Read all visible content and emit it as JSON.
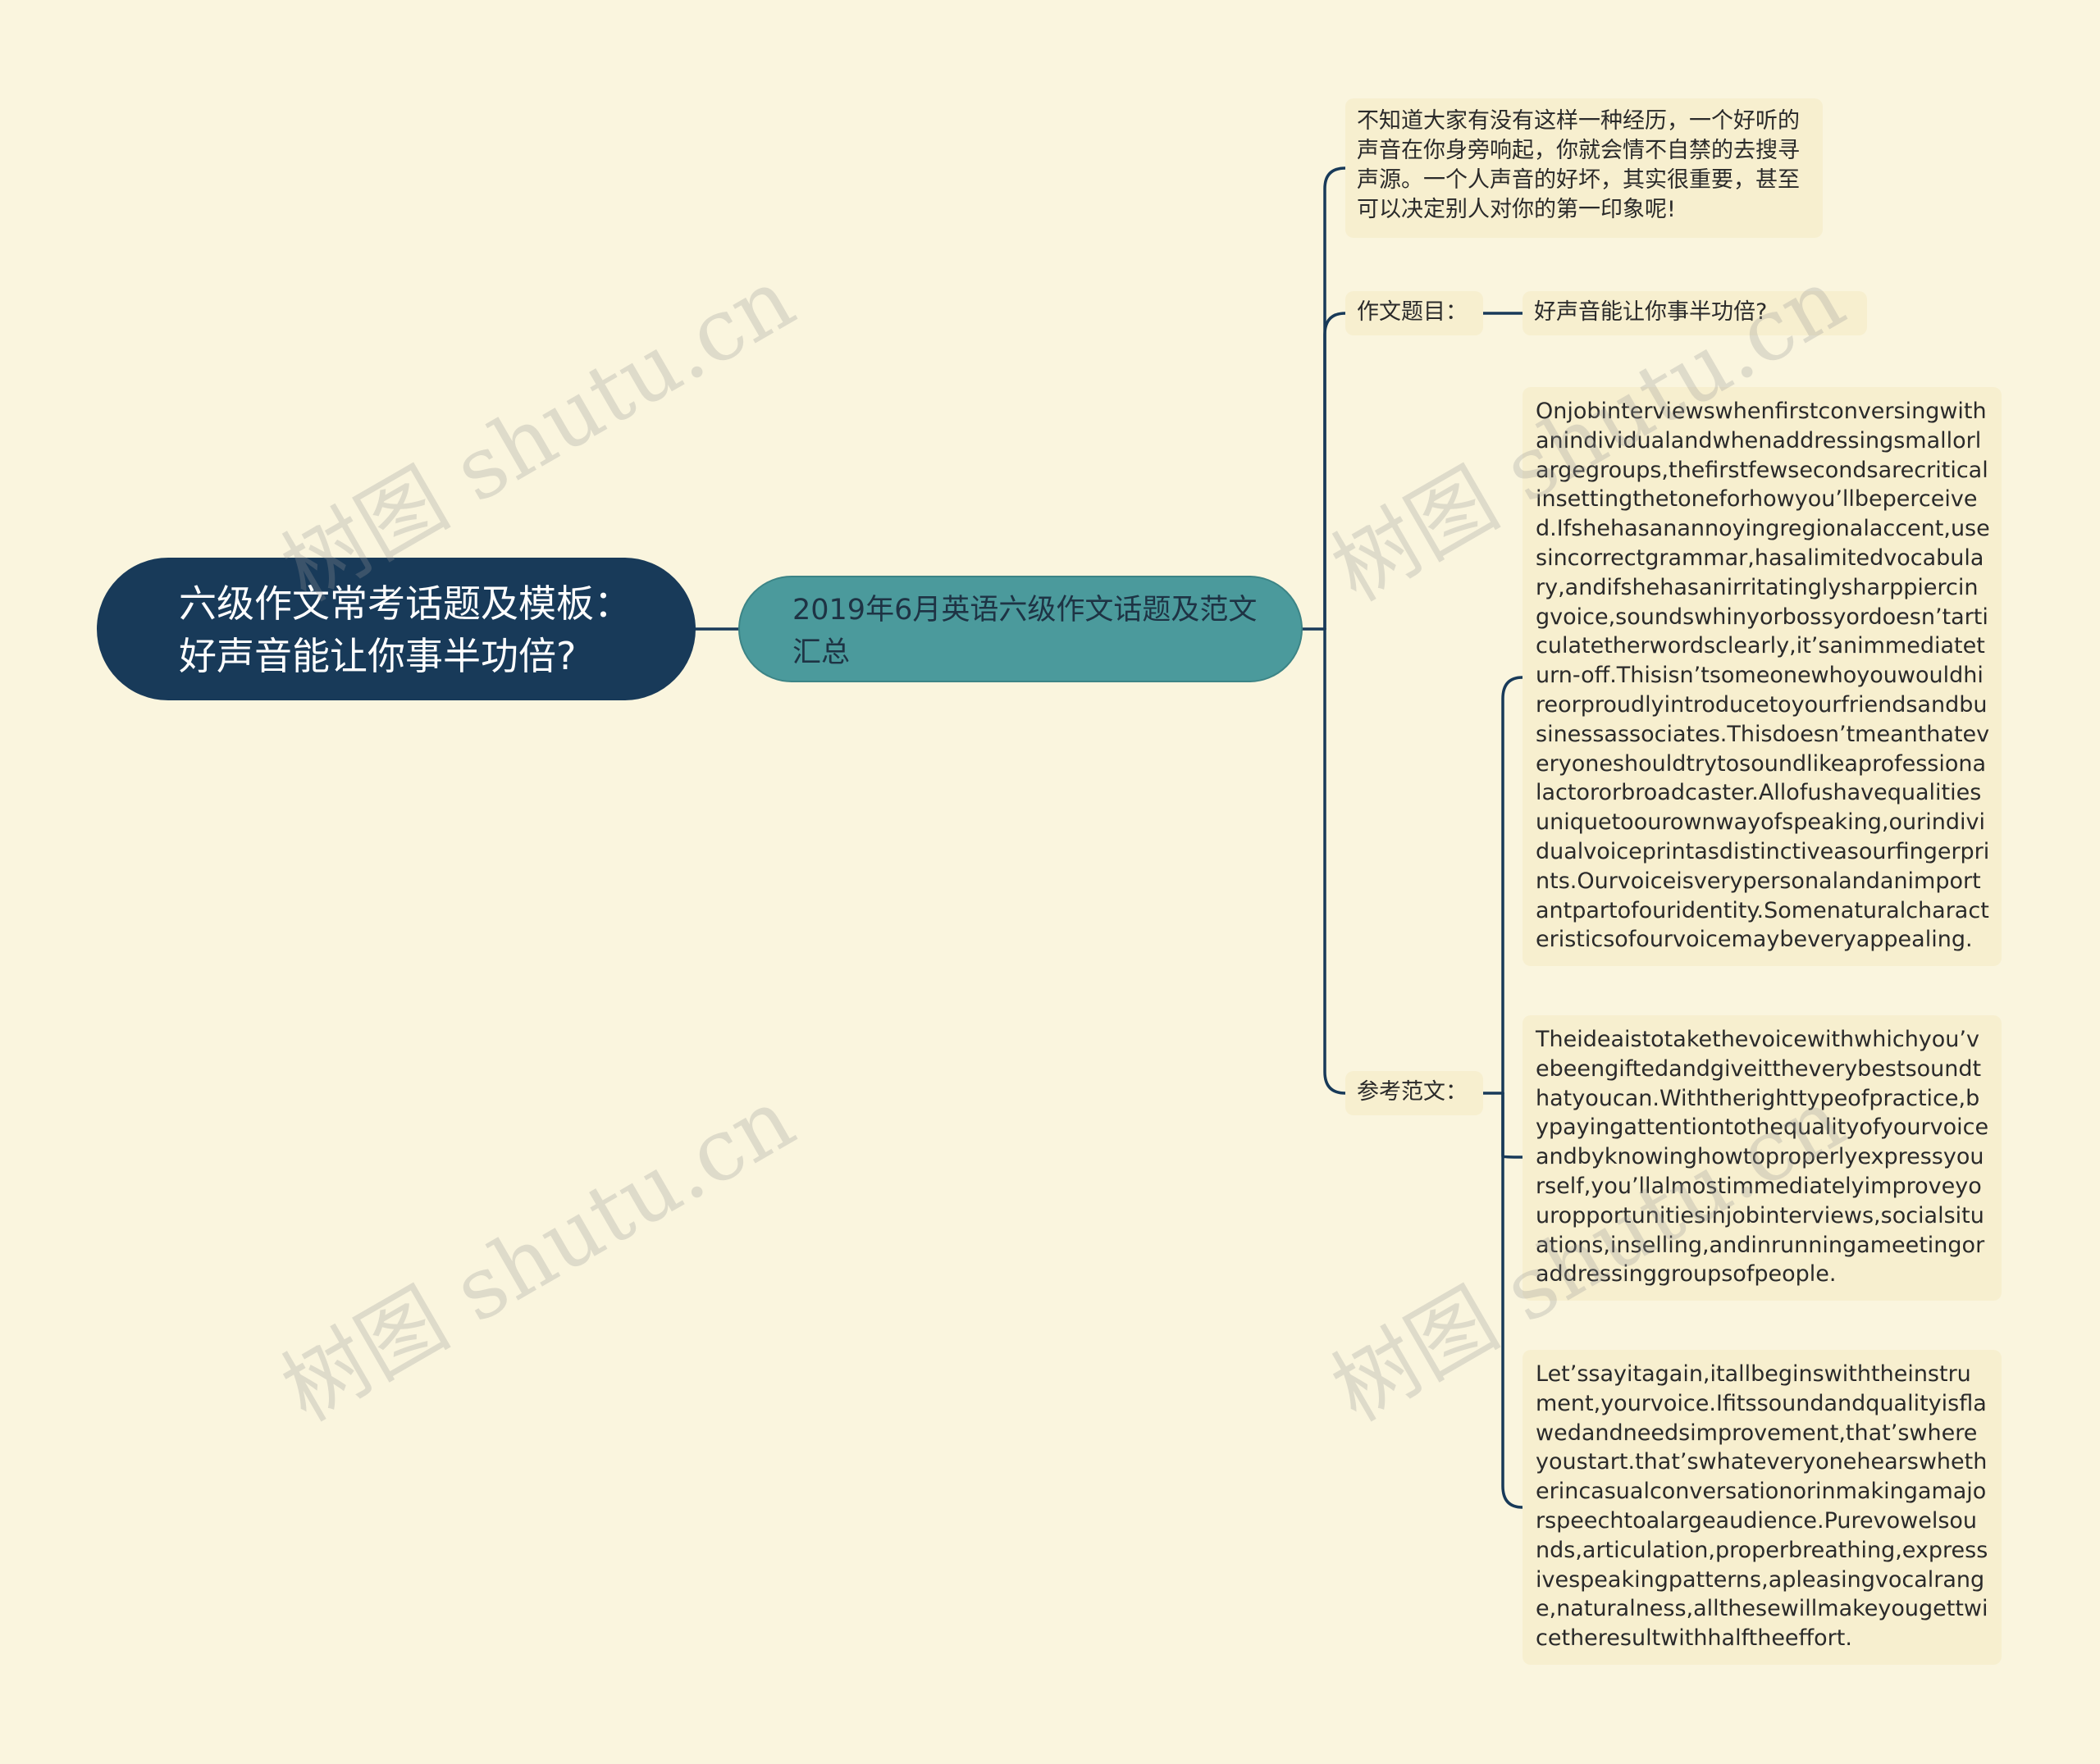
{
  "mindmap": {
    "root": "六级作文常考话题及模板：好声音能让你事半功倍?",
    "branch": "2019年6月英语六级作文话题及范文汇总",
    "intro": "不知道大家有没有这样一种经历，一个好听的声音在你身旁响起，你就会情不自禁的去搜寻声源。一个人声音的好坏，其实很重要，甚至可以决定别人对你的第一印象呢!",
    "topic_label": "作文题目：",
    "topic_answer": "好声音能让你事半功倍?",
    "reference_label": "参考范文：",
    "paragraphs": [
      "Onjobinterviewswhenfirstconversingwithanindividualandwhenaddressingsmallorlargegroups,thefirstfewsecondsarecriticalinsettingthetoneforhowyou’llbeperceived.Ifshehasanannoyingregionalaccent,usesincorrectgrammar,hasalimitedvocabulary,andifshehasanirritatinglysharppiercingvoice,soundswhinyorbossyordoesn’tarticulatetherwordsclearly,it’sanimmediateturn-off.Thisisn’tsomeonewhoyouwouldhireorproudlyintroducetoyourfriendsandbusinessassociates.Thisdoesn’tmeanthateveryoneshouldtrytosoundlikeaprofessionalactororbroadcaster.Allofushavequalitiesuniquetoourownwayofspeaking,ourindividualvoiceprintasdistinctiveasourfingerprints.Ourvoiceisverypersonalandanimportantpartofouridentity.Somenaturalcharacteristicsofourvoicemaybeveryappealing.",
      "Theideaistotakethevoicewithwhichyou’vebeengiftedandgiveittheverybestsoundthatyoucan.Withtherighttypeofpractice,bypayingattentiontothequalityofyourvoiceandbyknowinghowtoproperlyexpressyourself,you’llalmostimmediatelyimproveyouropportunitiesinjobinterviews,socialsituations,inselling,andinrunningameetingoraddressinggroupsofpeople.",
      "Let’ssayitagain,itallbeginswiththeinstrument,yourvoice.Ifitssoundandqualityisflawedandneedsimprovement,that’swhereyoustart.that’swhateveryonehearswhetherincasualconversationorinmakingamajorspeechtoalargeaudience.Purevowelsounds,articulation,properbreathing,expressivespeakingpatterns,apleasingvocalrange,naturalness,allthesewillmakeyougettwicetheresultwithhalftheeffort."
    ]
  },
  "watermark": "树图 shutu.cn",
  "colors": {
    "background": "#faf5de",
    "root_fill": "#183a59",
    "branch_fill": "#4b9a9c",
    "card_fill": "#f7efcf",
    "connector": "#183a59"
  }
}
